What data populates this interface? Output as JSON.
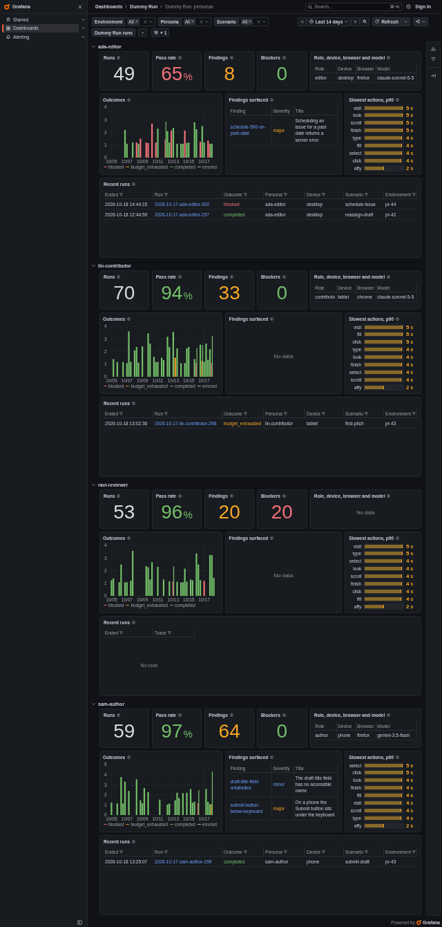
{
  "sidebar": {
    "title": "Grafana",
    "items": [
      {
        "label": "Starred",
        "selected": false
      },
      {
        "label": "Dashboards",
        "selected": true
      },
      {
        "label": "Alerting",
        "selected": false
      }
    ]
  },
  "breadcrumbs": [
    "Dashboards",
    "Dummy Run",
    "Dummy Run: personas"
  ],
  "search": {
    "placeholder": "Search...",
    "shortcut": "⌘+k"
  },
  "sign_in": "Sign in",
  "variables": [
    {
      "label": "Environment",
      "value": "All"
    },
    {
      "label": "Persona",
      "value": "All"
    },
    {
      "label": "Scenario",
      "value": "All"
    }
  ],
  "time_range": "Last 14 days",
  "refresh": "Refresh",
  "dashboard_link": "Dummy Run runs",
  "filter_count": "+ 1",
  "sections": [
    {
      "name": "ada-editor",
      "expanded": true,
      "stats": [
        {
          "title": "Runs",
          "value": "49",
          "color": "#d8d9da"
        },
        {
          "title": "Pass rate",
          "value": "65",
          "unit": "%",
          "color": "#f2707a"
        },
        {
          "title": "Findings",
          "value": "8",
          "color": "#f5a524"
        },
        {
          "title": "Blockers",
          "value": "0",
          "color": "#73bf69"
        }
      ],
      "profile": {
        "title": "Role, device, browser and model",
        "columns": [
          "Role",
          "Device",
          "Browser",
          "Model"
        ],
        "rows": [
          [
            "editor",
            "desktop",
            "firefox",
            "claude-sonnet-5-5"
          ]
        ]
      },
      "outcomes": {
        "chart_data": {
          "type": "bar",
          "title": "Outcomes",
          "categories": [
            "10/05",
            null,
            null,
            null,
            null,
            null,
            null,
            null,
            "10/07",
            null,
            null,
            null,
            null,
            null,
            null,
            null,
            "10/09",
            null,
            null,
            null,
            null,
            null,
            null,
            null,
            "10/11",
            null,
            null,
            null,
            null,
            null,
            null,
            null,
            "10/13",
            null,
            null,
            null,
            null,
            null,
            null,
            null,
            "10/15",
            null,
            null,
            null,
            null,
            null,
            null,
            null,
            "10/17",
            null,
            null,
            null,
            null,
            null
          ],
          "series": [
            {
              "name": "blocked",
              "color": "#f2707a",
              "values": [
                null,
                null,
                null,
                null,
                null,
                null,
                null,
                null,
                null,
                null,
                null,
                null,
                null,
                1.2,
                null,
                1.5,
                null,
                null,
                1.2,
                1.15,
                null,
                2.7,
                null,
                1.2,
                null,
                null,
                null,
                null,
                1.45,
                null,
                null,
                2.15,
                null,
                null,
                null,
                null,
                null,
                null,
                2.15,
                null,
                null,
                null,
                null,
                null,
                null,
                null,
                1.25,
                null,
                null,
                null,
                1.35,
                1.1,
                null,
                null
              ]
            },
            {
              "name": "budget_exhausted",
              "color": "#f5a524",
              "values": [
                null,
                null,
                null,
                null,
                null,
                null,
                null,
                null,
                null,
                null,
                null,
                null,
                null,
                null,
                null,
                null,
                null,
                null,
                null,
                null,
                null,
                null,
                null,
                null,
                null,
                null,
                null,
                null,
                null,
                null,
                null,
                null,
                null,
                null,
                null,
                null,
                null,
                null,
                null,
                null,
                null,
                null,
                null,
                null,
                null,
                null,
                null,
                null,
                null,
                null,
                null,
                null,
                null,
                null
              ]
            },
            {
              "name": "completed",
              "color": "#73bf69",
              "values": [
                null,
                null,
                null,
                null,
                null,
                null,
                null,
                2.2,
                1.1,
                null,
                null,
                1.2,
                null,
                null,
                1.1,
                null,
                null,
                null,
                null,
                null,
                null,
                null,
                null,
                null,
                2.3,
                null,
                null,
                null,
                2.85,
                2.1,
                1.2,
                null,
                2.35,
                null,
                1.1,
                null,
                1.1,
                1.1,
                null,
                1.15,
                1.2,
                null,
                null,
                2.8,
                2.25,
                null,
                null,
                2.5,
                1.2,
                null,
                null,
                1.1,
                1.1,
                null
              ]
            },
            {
              "name": "errored",
              "color": "#c8c8d0",
              "values": [
                null,
                null,
                null,
                null,
                null,
                null,
                null,
                null,
                null,
                null,
                null,
                null,
                null,
                null,
                null,
                null,
                null,
                null,
                null,
                null,
                null,
                null,
                null,
                null,
                null,
                null,
                null,
                null,
                null,
                null,
                null,
                null,
                null,
                null,
                null,
                null,
                null,
                null,
                null,
                null,
                null,
                null,
                null,
                null,
                null,
                null,
                null,
                null,
                null,
                null,
                null,
                null,
                null,
                null
              ]
            }
          ],
          "ylim": [
            0,
            4
          ],
          "yticks": [
            0,
            1,
            2,
            3,
            4
          ]
        }
      },
      "findings": {
        "title": "Findings surfaced",
        "columns": [
          "Finding",
          "Severity",
          "Title"
        ],
        "rows": [
          {
            "finding": "schedule-500-on-past-date",
            "severity": {
              "label": "major",
              "kind": "warning"
            },
            "title": "Scheduling an issue for a past date returns a server error"
          }
        ]
      },
      "slowest": {
        "title": "Slowest actions, p90",
        "items": [
          {
            "label": "visit",
            "level": 1,
            "value": "5",
            "unit": "s"
          },
          {
            "label": "look",
            "level": 1,
            "value": "5",
            "unit": "s"
          },
          {
            "label": "scroll",
            "level": 1,
            "value": "5",
            "unit": "s"
          },
          {
            "label": "finish",
            "level": 0.995,
            "value": "5",
            "unit": "s"
          },
          {
            "label": "type",
            "level": 0.99,
            "value": "4",
            "unit": "s"
          },
          {
            "label": "fill",
            "level": 0.99,
            "value": "4",
            "unit": "s"
          },
          {
            "label": "select",
            "level": 0.98,
            "value": "4",
            "unit": "s"
          },
          {
            "label": "click",
            "level": 0.96,
            "value": "4",
            "unit": "s"
          },
          {
            "label": "affy",
            "level": 0.51,
            "value": "2",
            "unit": "s"
          }
        ]
      },
      "recent_runs": {
        "title": "Recent runs",
        "columns": [
          "Ended",
          "Run",
          "Outcome",
          "Persona",
          "Device",
          "Scenario",
          "Environment"
        ],
        "rows": [
          {
            "ended": "2026-10-18 14:44:15",
            "run": "2026-10-17-ada-editor-300",
            "outcome": {
              "label": "blocked",
              "kind": "error"
            },
            "persona": "ada-editor",
            "device": "desktop",
            "scenario": "schedule-issue",
            "environment": "pr-44"
          },
          {
            "ended": "2026-10-18 12:44:59",
            "run": "2026-10-17-ada-editor-297",
            "outcome": {
              "label": "completed",
              "kind": "success"
            },
            "persona": "ada-editor",
            "device": "desktop",
            "scenario": "reassign-draft",
            "environment": "pr-42"
          }
        ]
      }
    },
    {
      "name": "lin-contributor",
      "expanded": true,
      "stats": [
        {
          "title": "Runs",
          "value": "70",
          "color": "#d8d9da"
        },
        {
          "title": "Pass rate",
          "value": "94",
          "unit": "%",
          "color": "#73bf69"
        },
        {
          "title": "Findings",
          "value": "33",
          "color": "#f5a524"
        },
        {
          "title": "Blockers",
          "value": "0",
          "color": "#73bf69"
        }
      ],
      "profile": {
        "title": "Role, device, browser and model",
        "columns": [
          "Role",
          "Device",
          "Browser",
          "Model"
        ],
        "rows": [
          [
            "contributo",
            "tablet",
            "chrome",
            "claude-sonnet-5-5"
          ]
        ]
      },
      "outcomes": {
        "chart_data": {
          "type": "bar",
          "title": "Outcomes",
          "categories": [
            "10/05",
            null,
            null,
            null,
            null,
            null,
            null,
            null,
            "10/07",
            null,
            null,
            null,
            null,
            null,
            null,
            null,
            "10/09",
            null,
            null,
            null,
            null,
            null,
            null,
            null,
            "10/11",
            null,
            null,
            null,
            null,
            null,
            null,
            null,
            "10/13",
            null,
            null,
            null,
            null,
            null,
            null,
            null,
            "10/15",
            null,
            null,
            null,
            null,
            null,
            null,
            null,
            "10/17",
            null,
            null,
            null,
            null,
            null
          ],
          "series": [
            {
              "name": "blocked",
              "color": "#f2707a",
              "values": [
                null,
                null,
                null,
                null,
                null,
                null,
                null,
                null,
                null,
                null,
                null,
                null,
                null,
                null,
                null,
                null,
                null,
                null,
                null,
                null,
                null,
                null,
                null,
                null,
                null,
                null,
                null,
                null,
                null,
                null,
                null,
                null,
                null,
                null,
                null,
                null,
                null,
                null,
                null,
                null,
                null,
                null,
                null,
                null,
                1.1,
                null,
                null,
                null,
                null,
                null,
                null,
                null,
                1.08,
                null
              ]
            },
            {
              "name": "budget_exhausted",
              "color": "#f5a524",
              "values": [
                null,
                null,
                null,
                null,
                null,
                null,
                null,
                null,
                null,
                null,
                null,
                null,
                null,
                null,
                null,
                null,
                null,
                null,
                null,
                null,
                null,
                null,
                null,
                null,
                null,
                null,
                null,
                null,
                null,
                null,
                null,
                null,
                null,
                1.51,
                null,
                null,
                null,
                null,
                null,
                null,
                null,
                null,
                null,
                null,
                null,
                null,
                null,
                1.25,
                null,
                null,
                null,
                null,
                null,
                null
              ]
            },
            {
              "name": "completed",
              "color": "#73bf69",
              "values": [
                null,
                1.4,
                null,
                1.17,
                null,
                null,
                1.17,
                null,
                1.08,
                3.6,
                1.19,
                null,
                2.09,
                2.36,
                1.12,
                null,
                2.41,
                null,
                null,
                3.44,
                2.63,
                null,
                1.59,
                1.17,
                1.17,
                null,
                1.51,
                1.32,
                null,
                3.17,
                2.36,
                null,
                3.55,
                null,
                2.25,
                null,
                1.08,
                null,
                1.08,
                2.25,
                2.36,
                null,
                null,
                1.4,
                2.27,
                null,
                2.54,
                2.5,
                1.19,
                2.63,
                1.35,
                2.18,
                3.24,
                null
              ]
            },
            {
              "name": "errored",
              "color": "#c8c8d0",
              "values": [
                null,
                null,
                null,
                null,
                null,
                null,
                null,
                null,
                null,
                null,
                null,
                null,
                null,
                null,
                null,
                null,
                null,
                null,
                null,
                null,
                null,
                null,
                null,
                null,
                null,
                null,
                null,
                null,
                null,
                null,
                null,
                null,
                null,
                null,
                null,
                null,
                null,
                null,
                null,
                null,
                null,
                null,
                null,
                null,
                null,
                null,
                null,
                null,
                null,
                null,
                null,
                null,
                null,
                null
              ]
            }
          ],
          "ylim": [
            0,
            4
          ],
          "yticks": [
            0,
            1,
            2,
            3,
            4
          ]
        }
      },
      "findings": {
        "title": "Findings surfaced",
        "empty_text": "No data"
      },
      "slowest": {
        "title": "Slowest actions, p90",
        "items": [
          {
            "label": "visit",
            "level": 1,
            "value": "5",
            "unit": "s"
          },
          {
            "label": "fill",
            "level": 1,
            "value": "5",
            "unit": "s"
          },
          {
            "label": "click",
            "level": 0.99,
            "value": "5",
            "unit": "s"
          },
          {
            "label": "type",
            "level": 0.99,
            "value": "4",
            "unit": "s"
          },
          {
            "label": "look",
            "level": 0.99,
            "value": "4",
            "unit": "s"
          },
          {
            "label": "finish",
            "level": 0.98,
            "value": "4",
            "unit": "s"
          },
          {
            "label": "select",
            "level": 0.98,
            "value": "4",
            "unit": "s"
          },
          {
            "label": "scroll",
            "level": 0.96,
            "value": "4",
            "unit": "s"
          },
          {
            "label": "affy",
            "level": 0.51,
            "value": "2",
            "unit": "s"
          }
        ]
      },
      "recent_runs": {
        "title": "Recent runs",
        "columns": [
          "Ended",
          "Run",
          "Outcome",
          "Persona",
          "Device",
          "Scenario",
          "Environment"
        ],
        "rows": [
          {
            "ended": "2026-10-18 13:02:36",
            "run": "2026-10-17-lin-contributor-298",
            "outcome": {
              "label": "budget_exhausted",
              "kind": "warning"
            },
            "persona": "lin-contributor",
            "device": "tablet",
            "scenario": "first-pitch",
            "environment": "pr-43"
          }
        ]
      }
    },
    {
      "name": "ravi-reviewer",
      "expanded": true,
      "stats": [
        {
          "title": "Runs",
          "value": "53",
          "color": "#d8d9da"
        },
        {
          "title": "Pass rate",
          "value": "96",
          "unit": "%",
          "color": "#73bf69"
        },
        {
          "title": "Findings",
          "value": "20",
          "color": "#f5a524"
        },
        {
          "title": "Blockers",
          "value": "20",
          "color": "#f2707a"
        }
      ],
      "profile": {
        "title": "Role, device, browser and model",
        "empty_text": "No data"
      },
      "outcomes": {
        "chart_data": {
          "type": "bar",
          "title": "Outcomes",
          "categories": [
            "10/05",
            null,
            null,
            null,
            null,
            null,
            null,
            null,
            "10/07",
            null,
            null,
            null,
            null,
            null,
            null,
            null,
            "10/09",
            null,
            null,
            null,
            null,
            null,
            null,
            null,
            "10/11",
            null,
            null,
            null,
            null,
            null,
            null,
            null,
            "10/13",
            null,
            null,
            null,
            null,
            null,
            null,
            null,
            "10/15",
            null,
            null,
            null,
            null,
            null,
            null,
            null,
            "10/17",
            null,
            null,
            null,
            null,
            null
          ],
          "series": [
            {
              "name": "blocked",
              "color": "#f2707a",
              "values": [
                null,
                null,
                null,
                null,
                null,
                null,
                null,
                null,
                null,
                null,
                null,
                null,
                null,
                null,
                null,
                null,
                null,
                null,
                null,
                null,
                null,
                null,
                null,
                null,
                null,
                null,
                null,
                null,
                null,
                null,
                null,
                null,
                1.15,
                null,
                null,
                null,
                null,
                null,
                null,
                null,
                null,
                null,
                null,
                null,
                null,
                null,
                null,
                null,
                1.19,
                null,
                null,
                null,
                null,
                null
              ]
            },
            {
              "name": "budget_exhausted",
              "color": "#f5a524",
              "values": [
                null,
                null,
                null,
                null,
                null,
                null,
                null,
                null,
                null,
                null,
                null,
                null,
                null,
                null,
                null,
                null,
                null,
                null,
                null,
                null,
                null,
                null,
                null,
                null,
                null,
                null,
                null,
                null,
                null,
                null,
                null,
                null,
                null,
                null,
                null,
                null,
                null,
                null,
                null,
                null,
                null,
                null,
                null,
                null,
                null,
                null,
                null,
                null,
                null,
                null,
                null,
                null,
                null,
                null
              ]
            },
            {
              "name": "completed",
              "color": "#73bf69",
              "values": [
                1.24,
                1.39,
                null,
                null,
                1.08,
                2.49,
                null,
                1.08,
                1.08,
                null,
                1.19,
                3.57,
                null,
                null,
                null,
                null,
                null,
                null,
                2.36,
                2.27,
                1.3,
                2.67,
                null,
                null,
                2.31,
                null,
                null,
                1.3,
                null,
                null,
                1.15,
                null,
                2.34,
                null,
                1.12,
                null,
                1.06,
                1.08,
                2.16,
                1.12,
                null,
                1.3,
                1.24,
                null,
                3.37,
                2.49,
                1.24,
                null,
                null,
                null,
                null,
                3.24,
                3.24,
                1.42
              ]
            }
          ],
          "ylim": [
            0,
            4
          ],
          "yticks": [
            0,
            1,
            2,
            3,
            4
          ]
        }
      },
      "findings": {
        "title": "Findings surfaced",
        "empty_text": "No data"
      },
      "slowest": {
        "title": "Slowest actions, p90",
        "items": [
          {
            "label": "visit",
            "level": 1,
            "value": "5",
            "unit": "s"
          },
          {
            "label": "type",
            "level": 1,
            "value": "5",
            "unit": "s"
          },
          {
            "label": "select",
            "level": 0.99,
            "value": "4",
            "unit": "s"
          },
          {
            "label": "look",
            "level": 0.99,
            "value": "4",
            "unit": "s"
          },
          {
            "label": "scroll",
            "level": 0.98,
            "value": "4",
            "unit": "s"
          },
          {
            "label": "finish",
            "level": 0.98,
            "value": "4",
            "unit": "s"
          },
          {
            "label": "click",
            "level": 0.97,
            "value": "4",
            "unit": "s"
          },
          {
            "label": "fill",
            "level": 0.97,
            "value": "4",
            "unit": "s"
          },
          {
            "label": "affy",
            "level": 0.51,
            "value": "2",
            "unit": "s"
          }
        ]
      },
      "recent_runs": {
        "title": "Recent runs",
        "columns": [
          "Ended",
          "Trace"
        ],
        "empty_text": "No rows"
      }
    },
    {
      "name": "sam-author",
      "expanded": true,
      "stats": [
        {
          "title": "Runs",
          "value": "59",
          "color": "#d8d9da"
        },
        {
          "title": "Pass rate",
          "value": "97",
          "unit": "%",
          "color": "#73bf69"
        },
        {
          "title": "Findings",
          "value": "64",
          "color": "#f5a524"
        },
        {
          "title": "Blockers",
          "value": "0",
          "color": "#73bf69"
        }
      ],
      "profile": {
        "title": "Role, device, browser and model",
        "columns": [
          "Role",
          "Device",
          "Browser",
          "Model"
        ],
        "rows": [
          [
            "author",
            "phone",
            "firefox",
            "gemini-3.5-flash"
          ]
        ]
      },
      "outcomes": {
        "chart_data": {
          "type": "bar",
          "title": "Outcomes",
          "categories": [
            "10/05",
            null,
            null,
            null,
            null,
            null,
            null,
            null,
            "10/07",
            null,
            null,
            null,
            null,
            null,
            null,
            null,
            "10/09",
            null,
            null,
            null,
            null,
            null,
            null,
            null,
            "10/11",
            null,
            null,
            null,
            null,
            null,
            null,
            null,
            "10/13",
            null,
            null,
            null,
            null,
            null,
            null,
            null,
            "10/15",
            null,
            null,
            null,
            null,
            null,
            null,
            null,
            "10/17",
            null,
            null,
            null,
            null,
            null
          ],
          "series": [
            {
              "name": "blocked",
              "color": "#f2707a",
              "values": [
                null,
                null,
                null,
                null,
                null,
                null,
                null,
                null,
                null,
                null,
                null,
                null,
                null,
                null,
                null,
                null,
                null,
                null,
                null,
                null,
                null,
                null,
                null,
                null,
                null,
                null,
                null,
                null,
                null,
                null,
                null,
                null,
                null,
                null,
                null,
                null,
                null,
                null,
                null,
                null,
                null,
                null,
                null,
                null,
                null,
                1.17,
                null,
                null,
                null,
                null,
                null,
                null,
                null,
                null
              ]
            },
            {
              "name": "budget_exhausted",
              "color": "#f5a524",
              "values": [
                null,
                null,
                null,
                null,
                null,
                null,
                null,
                null,
                null,
                null,
                null,
                null,
                null,
                null,
                null,
                null,
                null,
                null,
                null,
                null,
                null,
                null,
                null,
                null,
                null,
                null,
                null,
                null,
                null,
                null,
                null,
                null,
                null,
                null,
                null,
                null,
                null,
                null,
                null,
                null,
                null,
                null,
                null,
                null,
                null,
                null,
                null,
                null,
                null,
                null,
                null,
                null,
                1.06,
                null
              ]
            },
            {
              "name": "completed",
              "color": "#73bf69",
              "values": [
                1.24,
                null,
                null,
                1.15,
                null,
                3.76,
                1.15,
                3.31,
                null,
                2.39,
                null,
                null,
                null,
                3.54,
                null,
                1.46,
                1.17,
                2.66,
                null,
                2.27,
                null,
                null,
                null,
                null,
                null,
                1.53,
                null,
                null,
                null,
                1.04,
                1.13,
                null,
                null,
                1.46,
                2.21,
                1.67,
                null,
                2.16,
                null,
                2.21,
                null,
                2.57,
                1.22,
                1.33,
                null,
                2.48,
                null,
                null,
                null,
                2.59,
                1.31,
                1.08,
                4.3,
                null
              ]
            },
            {
              "name": "errored",
              "color": "#c8c8d0",
              "values": [
                null,
                null,
                null,
                null,
                null,
                null,
                null,
                null,
                null,
                null,
                null,
                null,
                null,
                null,
                null,
                null,
                null,
                null,
                null,
                null,
                null,
                null,
                null,
                null,
                null,
                null,
                null,
                null,
                null,
                null,
                null,
                null,
                null,
                null,
                null,
                null,
                null,
                null,
                null,
                null,
                null,
                null,
                null,
                null,
                null,
                null,
                null,
                null,
                null,
                null,
                null,
                null,
                null,
                null
              ]
            }
          ],
          "ylim": [
            0,
            5
          ],
          "yticks": [
            0,
            1,
            2,
            3,
            4,
            5
          ]
        }
      },
      "findings": {
        "title": "Findings surfaced",
        "columns": [
          "Finding",
          "Severity",
          "Title"
        ],
        "rows": [
          {
            "finding": "draft-title-field-unlabelled",
            "severity": {
              "label": "minor",
              "kind": "info"
            },
            "title": "The draft title field has no accessible name"
          },
          {
            "finding": "submit-button-below-keyboard",
            "severity": {
              "label": "major",
              "kind": "warning"
            },
            "title": "On a phone the Submit button sits under the keyboard"
          }
        ]
      },
      "slowest": {
        "title": "Slowest actions, p90",
        "items": [
          {
            "label": "select",
            "level": 1,
            "value": "5",
            "unit": "s"
          },
          {
            "label": "click",
            "level": 1,
            "value": "5",
            "unit": "s"
          },
          {
            "label": "look",
            "level": 0.99,
            "value": "4",
            "unit": "s"
          },
          {
            "label": "finish",
            "level": 0.99,
            "value": "4",
            "unit": "s"
          },
          {
            "label": "fill",
            "level": 0.98,
            "value": "4",
            "unit": "s"
          },
          {
            "label": "visit",
            "level": 0.97,
            "value": "4",
            "unit": "s"
          },
          {
            "label": "scroll",
            "level": 0.97,
            "value": "4",
            "unit": "s"
          },
          {
            "label": "type",
            "level": 0.96,
            "value": "4",
            "unit": "s"
          },
          {
            "label": "affy",
            "level": 0.51,
            "value": "2",
            "unit": "s"
          }
        ]
      },
      "recent_runs": {
        "title": "Recent runs",
        "columns": [
          "Ended",
          "Run",
          "Outcome",
          "Persona",
          "Device",
          "Scenario",
          "Environment"
        ],
        "rows": [
          {
            "ended": "2026-10-18 13:25:07",
            "run": "2026-10-17-sam-author-299",
            "outcome": {
              "label": "completed",
              "kind": "success"
            },
            "persona": "sam-author",
            "device": "phone",
            "scenario": "submit-draft",
            "environment": "pr-43"
          }
        ]
      }
    }
  ],
  "footer": {
    "text": "Powered by",
    "brand": "Grafana"
  }
}
